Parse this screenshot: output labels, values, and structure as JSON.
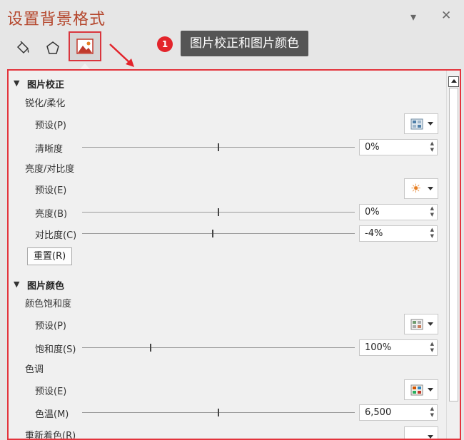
{
  "window": {
    "title": "设置背景格式"
  },
  "callout": {
    "badge": "1",
    "text": "图片校正和图片颜色"
  },
  "tabs": [
    {
      "name": "fill-tab",
      "icon": "paint-bucket-icon"
    },
    {
      "name": "effects-tab",
      "icon": "pentagon-icon"
    },
    {
      "name": "picture-tab",
      "icon": "picture-icon",
      "active": true
    }
  ],
  "correction": {
    "title": "图片校正",
    "sharpen_label": "锐化/柔化",
    "preset_label": "预设(P)",
    "clarity_label": "清晰度",
    "clarity_value": "0%",
    "brightness_group": "亮度/对比度",
    "preset2_label": "预设(E)",
    "brightness_label": "亮度(B)",
    "brightness_value": "0%",
    "contrast_label": "对比度(C)",
    "contrast_value": "-4%",
    "reset_label": "重置(R)"
  },
  "color": {
    "title": "图片颜色",
    "saturation_group": "颜色饱和度",
    "preset_label": "预设(P)",
    "saturation_label": "饱和度(S)",
    "saturation_value": "100%",
    "tone_group": "色调",
    "preset2_label": "预设(E)",
    "temperature_label": "色温(M)",
    "temperature_value": "6,500",
    "recolor_label": "重新着色(R)"
  },
  "sliders": {
    "clarity": 0.5,
    "brightness": 0.5,
    "contrast": 0.48,
    "saturation": 0.25,
    "temperature": 0.5
  },
  "colors": {
    "accent": "#b4462c",
    "highlight": "#d9363e",
    "badge": "#e3242b"
  }
}
